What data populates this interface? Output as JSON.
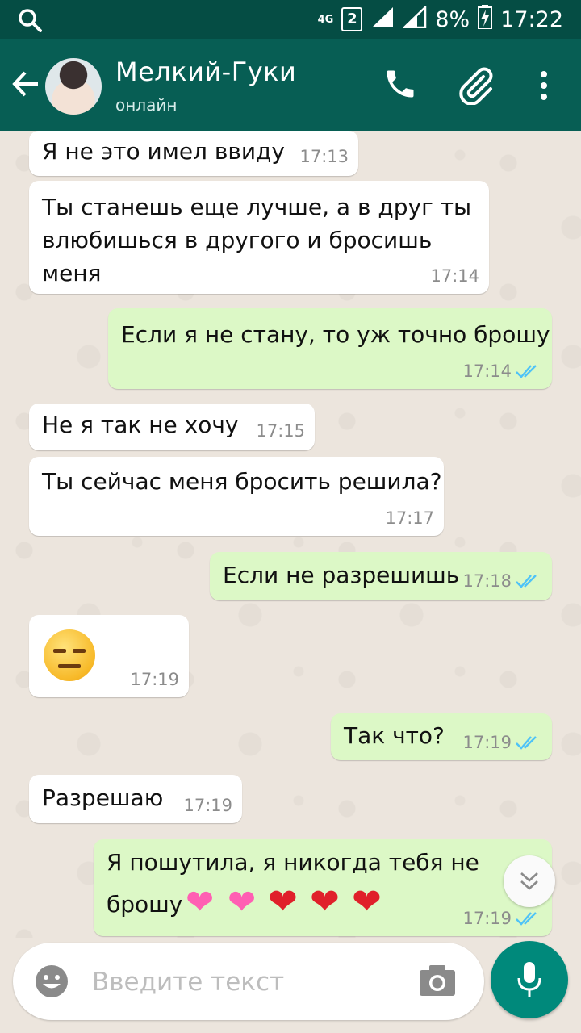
{
  "status_bar": {
    "network": "4G",
    "sim": "2",
    "battery": "8%",
    "time": "17:22"
  },
  "header": {
    "contact_name": "Мелкий-Гуки",
    "contact_status": "онлайн",
    "icons": [
      "back-arrow-icon",
      "call-icon",
      "attach-icon",
      "more-icon"
    ]
  },
  "messages": [
    {
      "dir": "in",
      "text": "Я не это имел ввиду",
      "time": "17:13"
    },
    {
      "dir": "in",
      "text_lines": [
        "Ты станешь еще лучше, а в друг ты",
        "влюбишься в другого и бросишь меня"
      ],
      "time": "17:14"
    },
    {
      "dir": "out",
      "text": "Если я не стану, то уж точно брошу",
      "time": "17:14",
      "status": "read"
    },
    {
      "dir": "in",
      "text": "Не я так не хочу",
      "time": "17:15"
    },
    {
      "dir": "in",
      "text": "Ты сейчас меня бросить решила?",
      "time": "17:17"
    },
    {
      "dir": "out",
      "text": "Если не разрешишь",
      "time": "17:18",
      "status": "read"
    },
    {
      "dir": "in",
      "emoji": "expressionless-face",
      "time": "17:19"
    },
    {
      "dir": "out",
      "text": "Так что?",
      "time": "17:19",
      "status": "read"
    },
    {
      "dir": "in",
      "text": "Разрешаю",
      "time": "17:19"
    },
    {
      "dir": "out",
      "text_lines": [
        "Я пошутила, я никогда тебя не",
        "брошу"
      ],
      "emojis": [
        "two-hearts",
        "two-hearts",
        "red-heart",
        "red-heart",
        "red-heart"
      ],
      "time": "17:19",
      "status": "read"
    }
  ],
  "input": {
    "placeholder": "Введите текст"
  },
  "colors": {
    "header": "#075e54",
    "status_bar": "#054d44",
    "incoming_bubble": "#ffffff",
    "outgoing_bubble": "#dcf8c6",
    "read_ticks": "#4fc3f7",
    "fab": "#00897b"
  }
}
